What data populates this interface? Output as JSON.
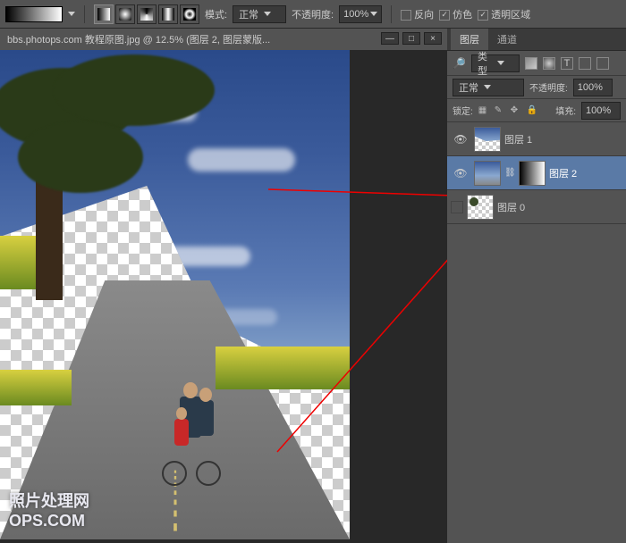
{
  "toolbar": {
    "mode_label": "模式:",
    "mode_value": "正常",
    "opacity_label": "不透明度:",
    "opacity_value": "100%",
    "reverse_label": "反向",
    "reverse_checked": false,
    "dither_label": "仿色",
    "dither_checked": true,
    "transparency_label": "透明区域",
    "transparency_checked": true
  },
  "document": {
    "tab_title": "bbs.photops.com 教程原图.jpg @ 12.5% (图层 2, 图层蒙版...",
    "watermark_cn": "照片处理网",
    "watermark_en": "OPS.COM"
  },
  "layers_panel": {
    "tabs": {
      "layers": "图层",
      "channels": "通道"
    },
    "filter_label": "类型",
    "blend_mode": "正常",
    "opacity_label": "不透明度:",
    "opacity_value": "100%",
    "lock_label": "锁定:",
    "fill_label": "填充:",
    "fill_value": "100%",
    "layers": [
      {
        "name": "图层 1",
        "visible": true,
        "selected": false
      },
      {
        "name": "图层 2",
        "visible": true,
        "selected": true
      },
      {
        "name": "图层 0",
        "visible": false,
        "selected": false
      }
    ]
  }
}
